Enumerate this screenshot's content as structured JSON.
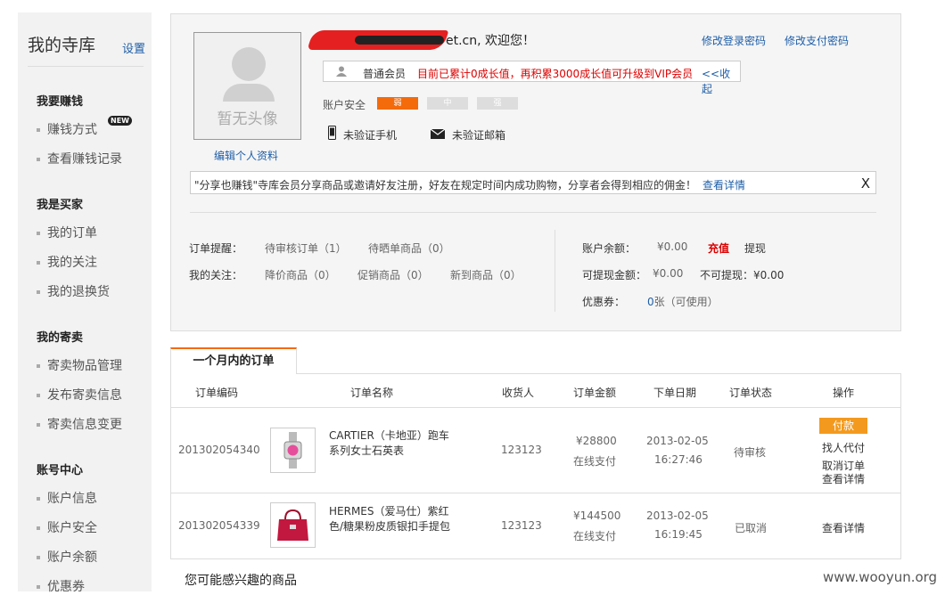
{
  "sidebar": {
    "title": "我的寺库",
    "settings": "设置",
    "new_badge": "NEW",
    "sections": [
      {
        "title": "我要赚钱",
        "items": [
          "赚钱方式",
          "查看赚钱记录"
        ]
      },
      {
        "title": "我是买家",
        "items": [
          "我的订单",
          "我的关注",
          "我的退换货"
        ]
      },
      {
        "title": "我的寄卖",
        "items": [
          "寄卖物品管理",
          "发布寄卖信息",
          "寄卖信息变更"
        ]
      },
      {
        "title": "账号中心",
        "items": [
          "账户信息",
          "账户安全",
          "账户余额",
          "优惠券"
        ]
      }
    ]
  },
  "profile": {
    "avatar_text": "暂无头像",
    "edit_link": "编辑个人资料",
    "welcome_suffix": "et.cn, 欢迎您！",
    "change_login_pwd": "修改登录密码",
    "change_pay_pwd": "修改支付密码",
    "member_level": "普通会员",
    "member_note": "目前已累计0成长值，再积累3000成长值可升级到VIP会员",
    "collapse": "<<收起",
    "security_label": "账户安全",
    "security_levels": [
      "弱",
      "中",
      "强"
    ],
    "phone_status": "未验证手机",
    "email_status": "未验证邮箱"
  },
  "notice": {
    "text": "\"分享也赚钱\"寺库会员分享商品或邀请好友注册，好友在规定时间内成功购物，分享者会得到相应的佣金！",
    "link": "查看详情",
    "close": "X"
  },
  "summary": {
    "order_reminder_label": "订单提醒：",
    "pending_review": "待审核订单（1）",
    "pending_share": "待晒单商品（0）",
    "follow_label": "我的关注：",
    "price_drop": "降价商品（0）",
    "promo": "促销商品（0）",
    "new_arrival": "新到商品（0）",
    "balance_label": "账户余额：",
    "balance_value": "¥0.00",
    "recharge": "充值",
    "withdraw": "提现",
    "withdrawable_label": "可提现金额：",
    "withdrawable_value": "¥0.00",
    "non_withdrawable": "不可提现：¥0.00",
    "coupon_label": "优惠券：",
    "coupon_count": "0",
    "coupon_unit": "张（可使用）"
  },
  "orders": {
    "tab": "一个月内的订单",
    "headers": [
      "订单编码",
      "订单名称",
      "收货人",
      "订单金额",
      "下单日期",
      "订单状态",
      "操作"
    ],
    "rows": [
      {
        "id": "201302054340",
        "name_line1": "CARTIER（卡地亚）跑车",
        "name_line2": "系列女士石英表",
        "receiver": "123123",
        "amount": "¥28800",
        "pay_method": "在线支付",
        "date": "2013-02-05",
        "time": "16:27:46",
        "status": "待审核",
        "actions": [
          "付款",
          "找人代付",
          "取消订单",
          "查看详情"
        ]
      },
      {
        "id": "201302054339",
        "name_line1": "HERMES（爱马仕）紫红",
        "name_line2": "色/糖果粉皮质银扣手提包",
        "receiver": "123123",
        "amount": "¥144500",
        "pay_method": "在线支付",
        "date": "2013-02-05",
        "time": "16:19:45",
        "status": "已取消",
        "actions": [
          "查看详情"
        ]
      }
    ]
  },
  "footer": {
    "maybe_like": "您可能感兴趣的商品",
    "watermark": "www.wooyun.org"
  },
  "colors": {
    "accent": "#f46b0c",
    "link": "#1f5fa8",
    "warning": "#dd0000",
    "pay_button": "#f39a1e"
  }
}
